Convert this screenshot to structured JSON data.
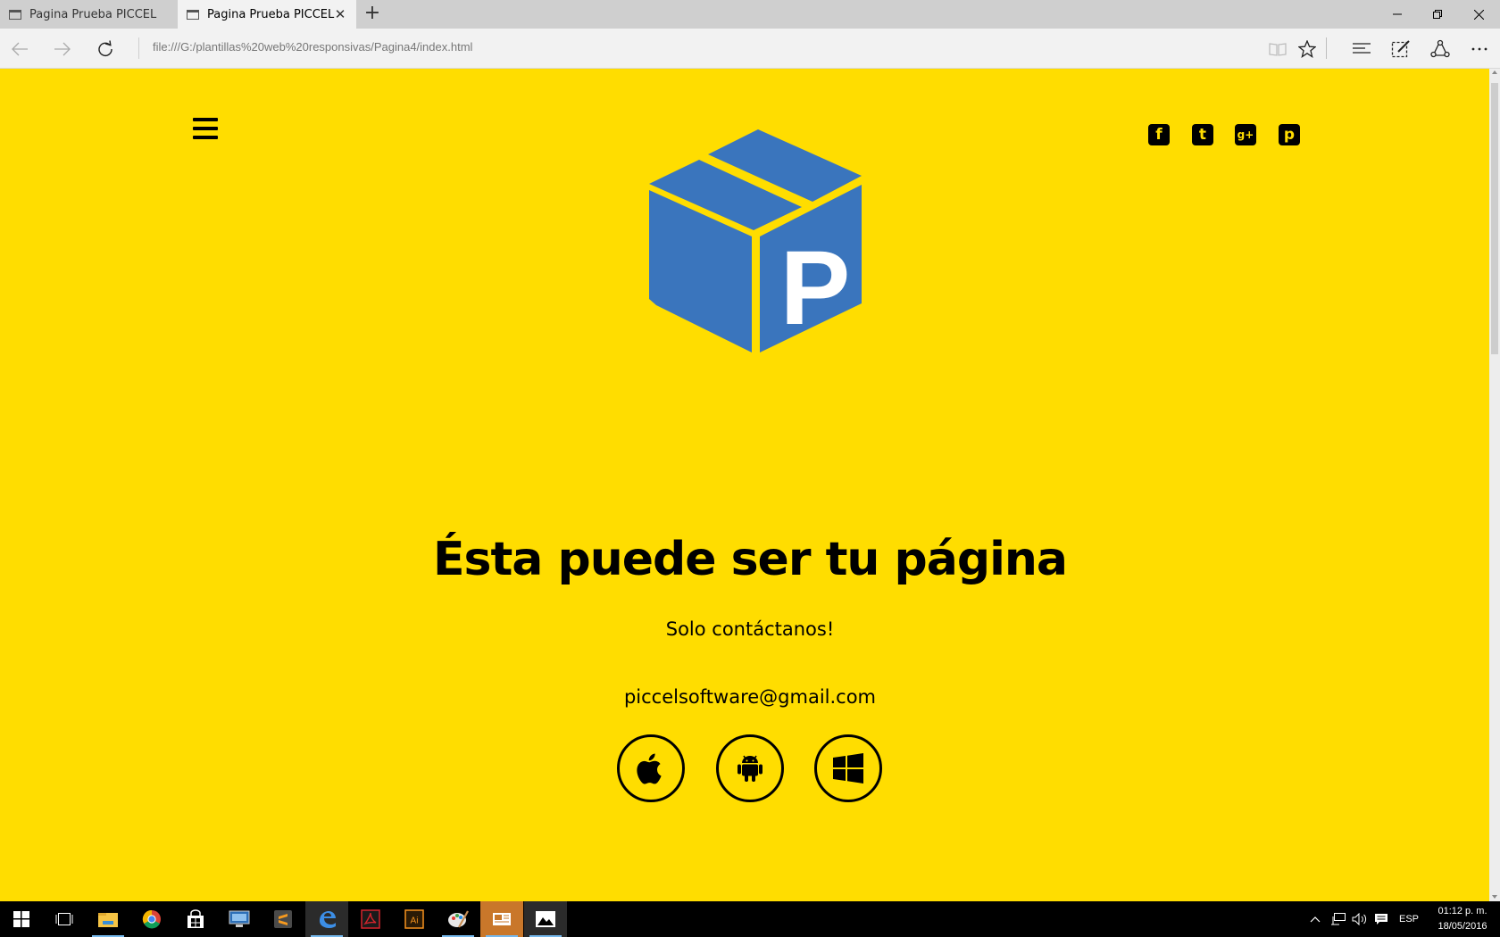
{
  "browser": {
    "tabs": [
      {
        "label": "Pagina Prueba PICCEL",
        "active": false
      },
      {
        "label": "Pagina Prueba PICCEL",
        "active": true
      }
    ],
    "address": "file:///G:/plantillas%20web%20responsivas/Pagina4/index.html"
  },
  "page": {
    "background": "#ffdd00",
    "logo_letter": "P",
    "logo_color": "#3a75bd",
    "social_icons": [
      "facebook-icon",
      "twitter-icon",
      "google-plus-icon",
      "pinterest-icon"
    ],
    "social_glyphs": {
      "facebook": "f",
      "twitter": "t",
      "google_plus": "g+",
      "pinterest": "p"
    },
    "headline": "Ésta puede ser tu página",
    "subtitle": "Solo contáctanos!",
    "email": "piccelsoftware@gmail.com",
    "store_icons": [
      "apple-icon",
      "android-icon",
      "windows-icon"
    ]
  },
  "taskbar": {
    "language": "ESP",
    "time": "01:12 p. m.",
    "date": "18/05/2016"
  }
}
